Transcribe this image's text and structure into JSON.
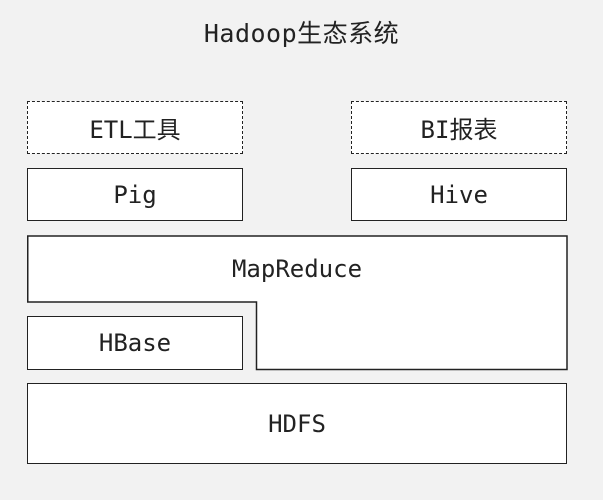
{
  "diagram": {
    "title": "Hadoop生态系统",
    "etl_label": "ETL工具",
    "bi_label": "BI报表",
    "pig_label": "Pig",
    "hive_label": "Hive",
    "mapreduce_label": "MapReduce",
    "hbase_label": "HBase",
    "hdfs_label": "HDFS"
  }
}
